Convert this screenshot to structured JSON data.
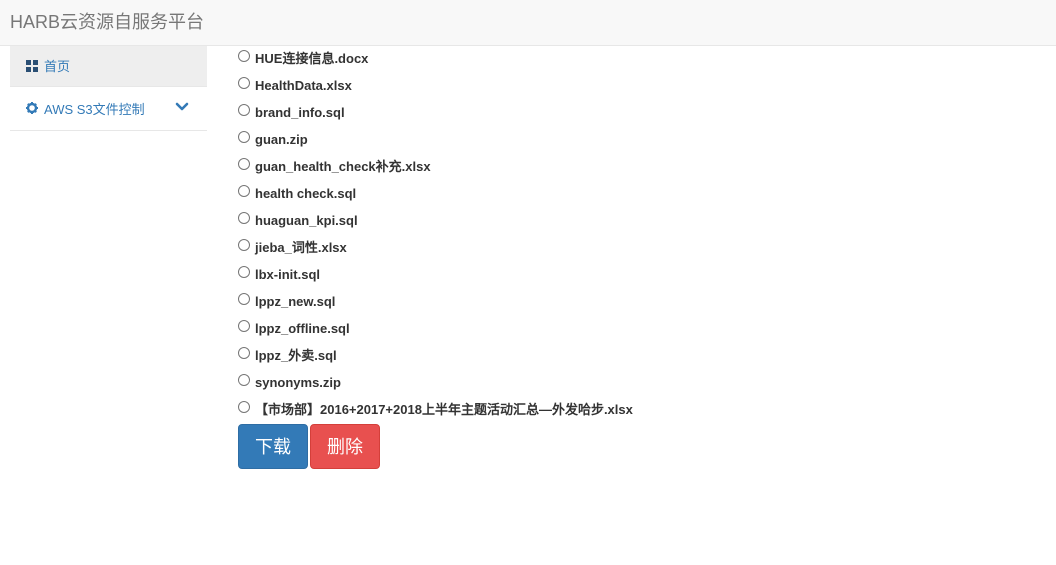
{
  "header": {
    "brand": "HARB云资源自服务平台"
  },
  "sidebar": {
    "items": [
      {
        "label": "首页",
        "icon": "dashboard-grid-icon"
      },
      {
        "label": "AWS S3文件控制",
        "icon": "gear-icon",
        "expand_icon": "chevron-down-icon"
      }
    ]
  },
  "files": [
    "HUE连接信息.docx",
    "HealthData.xlsx",
    "brand_info.sql",
    "guan.zip",
    "guan_health_check补充.xlsx",
    "health check.sql",
    "huaguan_kpi.sql",
    "jieba_词性.xlsx",
    "lbx-init.sql",
    "lppz_new.sql",
    "lppz_offline.sql",
    "lppz_外卖.sql",
    "synonyms.zip",
    "【市场部】2016+2017+2018上半年主题活动汇总—外发哈步.xlsx"
  ],
  "actions": {
    "download_label": "下载",
    "delete_label": "删除"
  },
  "colors": {
    "primary": "#337ab7",
    "danger": "#e8504f",
    "navbar_bg": "#f8f8f8"
  }
}
